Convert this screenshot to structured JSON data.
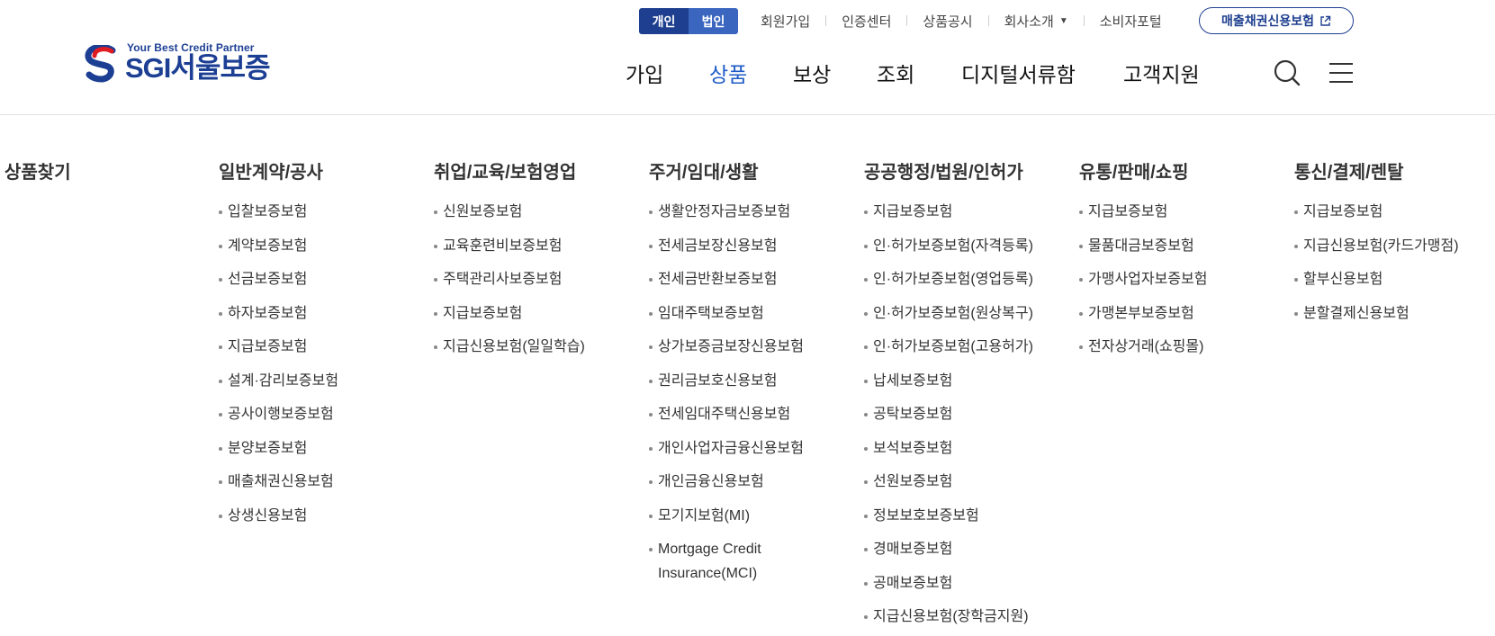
{
  "logo": {
    "tagline": "Your Best Credit Partner",
    "brand": "SGI서울보증"
  },
  "customer_toggle": {
    "personal": "개인",
    "corporate": "법인"
  },
  "util_nav": [
    {
      "label": "회원가입"
    },
    {
      "label": "인증센터"
    },
    {
      "label": "상품공시"
    },
    {
      "label": "회사소개"
    },
    {
      "label": "소비자포털"
    }
  ],
  "util_caret": "▼",
  "external_button": {
    "label": "매출채권신용보험",
    "icon": "external-link-icon"
  },
  "gnb": [
    "가입",
    "상품",
    "보상",
    "조회",
    "디지털서류함",
    "고객지원"
  ],
  "gnb_active_index": 1,
  "icons": {
    "search": "search-icon",
    "menu": "hamburger-menu-icon"
  },
  "colors": {
    "brand": "#1e3f8f",
    "accent": "#1e5bc6",
    "brand_red": "#e11b22"
  },
  "mega": {
    "find_title": "상품찾기",
    "columns": [
      {
        "title": "일반계약/공사",
        "items": [
          "입찰보증보험",
          "계약보증보험",
          "선금보증보험",
          "하자보증보험",
          "지급보증보험",
          "설계·감리보증보험",
          "공사이행보증보험",
          "분양보증보험",
          "매출채권신용보험",
          "상생신용보험"
        ]
      },
      {
        "title": "취업/교육/보험영업",
        "items": [
          "신원보증보험",
          "교육훈련비보증보험",
          "주택관리사보증보험",
          "지급보증보험",
          "지급신용보험(일일학습)"
        ]
      },
      {
        "title": "주거/임대/생활",
        "items": [
          "생활안정자금보증보험",
          "전세금보장신용보험",
          "전세금반환보증보험",
          "임대주택보증보험",
          "상가보증금보장신용보험",
          "권리금보호신용보험",
          "전세임대주택신용보험",
          "개인사업자금융신용보험",
          "개인금융신용보험",
          "모기지보험(MI)",
          "Mortgage Credit Insurance(MCI)"
        ]
      },
      {
        "title": "공공행정/법원/인허가",
        "items": [
          "지급보증보험",
          "인·허가보증보험(자격등록)",
          "인·허가보증보험(영업등록)",
          "인·허가보증보험(원상복구)",
          "인·허가보증보험(고용허가)",
          "납세보증보험",
          "공탁보증보험",
          "보석보증보험",
          "선원보증보험",
          "정보보호보증보험",
          "경매보증보험",
          "공매보증보험",
          "지급신용보험(장학금지원)"
        ]
      },
      {
        "title": "유통/판매/쇼핑",
        "items": [
          "지급보증보험",
          "물품대금보증보험",
          "가맹사업자보증보험",
          "가맹본부보증보험",
          "전자상거래(쇼핑몰)"
        ]
      },
      {
        "title": "통신/결제/렌탈",
        "items": [
          "지급보증보험",
          "지급신용보험(카드가맹점)",
          "할부신용보험",
          "분할결제신용보험"
        ]
      }
    ]
  }
}
